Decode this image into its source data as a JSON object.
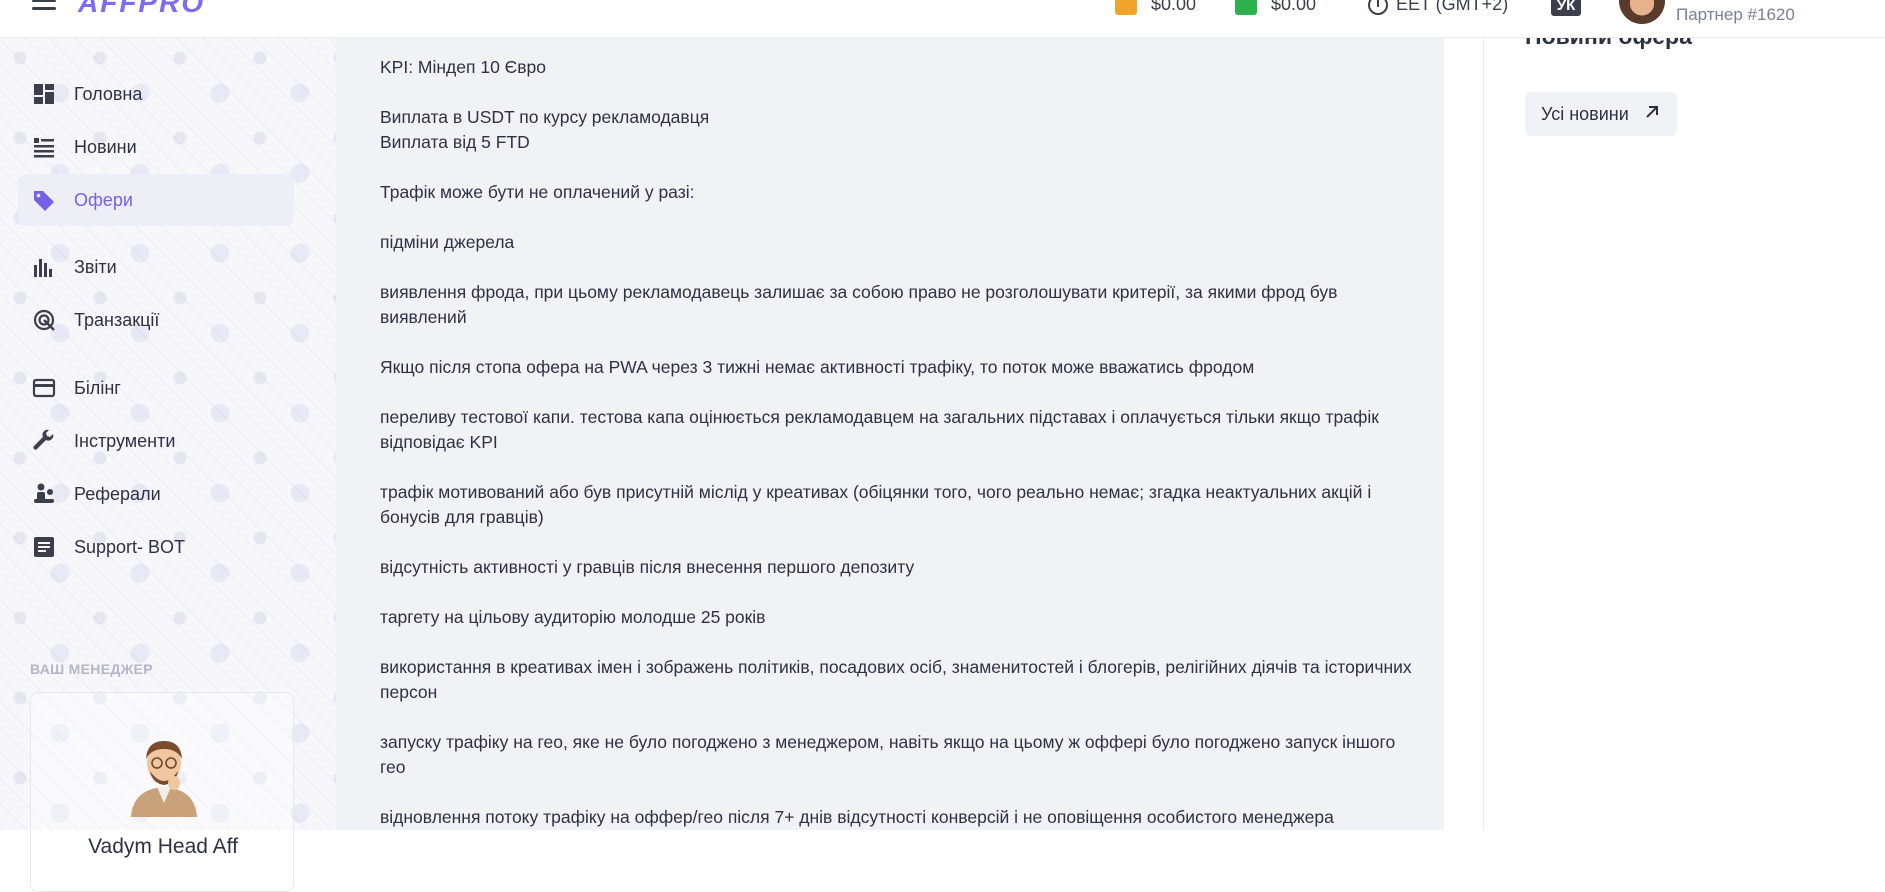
{
  "header": {
    "logo": "AFFPRO",
    "balance_orange": "$0.00",
    "balance_green": "$0.00",
    "timezone": "EET (GMT+2)",
    "language": "УК",
    "partner": "Партнер #1620",
    "colors": {
      "orange": "#f0a52a",
      "green": "#2bb24c",
      "accent": "#7461e8"
    }
  },
  "sidebar": {
    "items": [
      {
        "label": "Головна",
        "icon": "dashboard-icon"
      },
      {
        "label": "Новини",
        "icon": "news-icon"
      },
      {
        "label": "Офери",
        "icon": "tag-icon",
        "active": true
      },
      {
        "label": "Звіти",
        "icon": "bar-chart-icon"
      },
      {
        "label": "Транзакції",
        "icon": "radar-icon"
      },
      {
        "label": "Білінг",
        "icon": "credit-card-icon"
      },
      {
        "label": "Інструменти",
        "icon": "wrench-icon"
      },
      {
        "label": "Реферали",
        "icon": "referral-icon"
      },
      {
        "label": "Support- BOT",
        "icon": "document-icon"
      }
    ],
    "manager_section_title": "ВАШ МЕНЕДЖЕР",
    "manager_name": "Vadym Head Aff"
  },
  "offer": {
    "paragraphs": [
      [
        "KPI: Мiндеп 10 Євро"
      ],
      [
        "Виплата в USDT по курсу рекламодавця",
        "Виплата вiд 5 FTD"
      ],
      [
        "Трафiк може бути не оплачений у разi:"
      ],
      [
        "пiдмiни джерела"
      ],
      [
        "виявлення фрода, при цьому рекламодавець залишає за собою право не розголошувати критерiї, за якими фрод був виявлений"
      ],
      [
        "Якщо пiсля стопа офера на PWA через 3 тижнi немає активностi трафiку, то поток може вважатись фродом"
      ],
      [
        "переливу тестової капи. тестова капа оцiнюється рекламодавцем на загальних пiдставах i оплачується тiльки якщо трафiк вiдповiдає KPI"
      ],
      [
        "трафiк мотивований або був присутнiй мiслiд у креативах (обiцянки того, чого реально немає; згадка неактуальних акцiй i бонусiв для гравцiв)"
      ],
      [
        "вiдсутнiсть активностi у гравцiв пiсля внесення першого депозиту"
      ],
      [
        "таргету на цiльову аудиторiю молодше 25 рокiв"
      ],
      [
        "використання в креативах iмен i зображень полiтикiв, посадових осiб, знаменитостей i блогерiв, релiгiйних дiячiв та iсторичних персон"
      ],
      [
        "запуску трафiку на гео, яке не було погоджено з менеджером, навiть якщо на цьому ж оффері було погоджено запуск iншого гео"
      ],
      [
        "вiдновлення потоку трафiку на оффер/гео пiсля 7+ днiв вiдсутностi конверсiй i не оповiщення особистого менеджера"
      ]
    ]
  },
  "right_panel": {
    "title": "Новини офера",
    "all_news_button": "Усі новини"
  }
}
